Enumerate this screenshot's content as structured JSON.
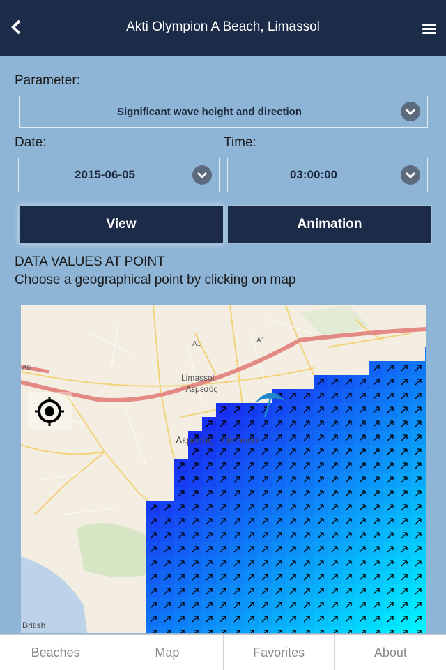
{
  "header": {
    "title": "Akti Olympion A Beach, Limassol",
    "back_icon": "chevron-left-icon",
    "menu_icon": "hamburger-menu-icon"
  },
  "form": {
    "parameter_label": "Parameter:",
    "parameter_value": "Significant wave height and direction",
    "date_label": "Date:",
    "date_value": "2015-06-05",
    "time_label": "Time:",
    "time_value": "03:00:00"
  },
  "buttons": {
    "view": "View",
    "animation": "Animation"
  },
  "info": {
    "heading": "DATA VALUES AT POINT",
    "text": "Choose a geographical point by clicking on map"
  },
  "map": {
    "label_limassol": "Limassol",
    "label_limassol_gr": "- Λεμεσός",
    "label_city": "Λεμεσός - Limassol",
    "road_a1_left": "A1",
    "road_a1_right": "A1",
    "road_a6": "A6",
    "attribution": "British",
    "colors": {
      "deep": "#1a1ef0",
      "shallow": "#00f5ff",
      "road": "#e57373"
    }
  },
  "tabs": [
    "Beaches",
    "Map",
    "Favorites",
    "About"
  ]
}
